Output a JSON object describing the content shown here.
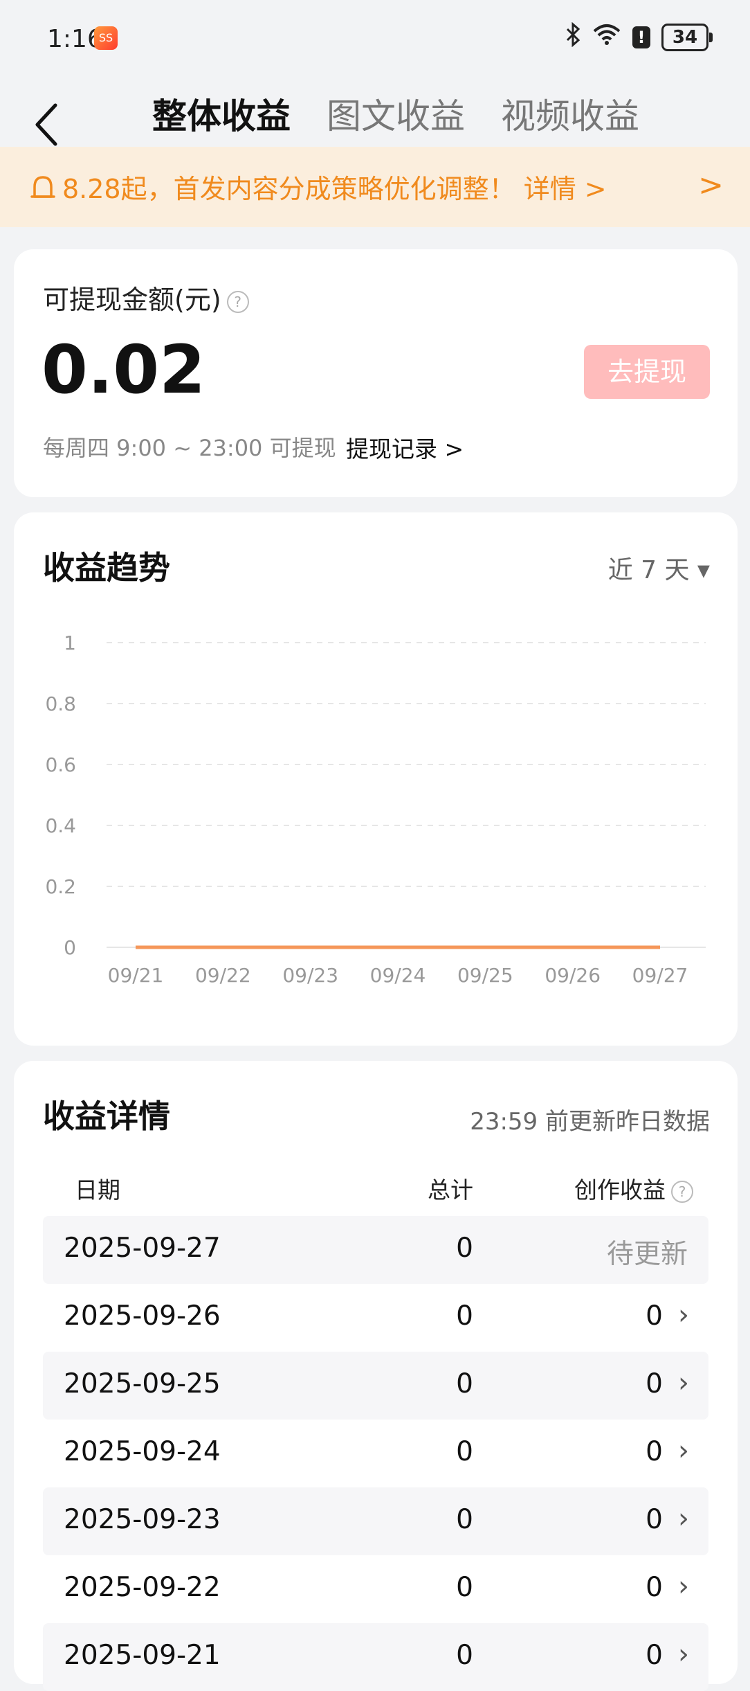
{
  "status_bar": {
    "time": "1:16",
    "app_icon_text": "SS",
    "battery": "34"
  },
  "nav": {
    "tabs": [
      {
        "label": "整体收益",
        "active": true
      },
      {
        "label": "图文收益",
        "active": false
      },
      {
        "label": "视频收益",
        "active": false
      }
    ]
  },
  "banner": {
    "text": "8.28起，首发内容分成策略优化调整！ 详情 >",
    "chevron": ">"
  },
  "balance": {
    "label": "可提现金额(元)",
    "help": "?",
    "amount": "0.02",
    "withdraw_label": "去提现",
    "note": "每周四 9:00 ~ 23:00 可提现",
    "record_label": "提现记录 >",
    "withdraw_enabled": false,
    "withdraw_color": "#ffbcbc"
  },
  "trend": {
    "title": "收益趋势",
    "range_label": "近 7 天 ▾"
  },
  "chart_data": {
    "type": "line",
    "x": [
      "09/21",
      "09/22",
      "09/23",
      "09/24",
      "09/25",
      "09/26",
      "09/27"
    ],
    "series": [
      {
        "values": [
          0,
          0,
          0,
          0,
          0,
          0,
          0
        ],
        "color": "#f5975a"
      }
    ],
    "yticks": [
      "0",
      "0.2",
      "0.4",
      "0.6",
      "0.8",
      "1"
    ],
    "ylim": [
      0,
      1
    ],
    "grid": true
  },
  "details": {
    "title": "收益详情",
    "note": "23:59 前更新昨日数据",
    "headers": {
      "date": "日期",
      "total": "总计",
      "creation": "创作收益",
      "help": "?"
    },
    "rows": [
      {
        "date": "2025-09-27",
        "total": "0",
        "creation": "待更新",
        "pending": true
      },
      {
        "date": "2025-09-26",
        "total": "0",
        "creation": "0"
      },
      {
        "date": "2025-09-25",
        "total": "0",
        "creation": "0"
      },
      {
        "date": "2025-09-24",
        "total": "0",
        "creation": "0"
      },
      {
        "date": "2025-09-23",
        "total": "0",
        "creation": "0"
      },
      {
        "date": "2025-09-22",
        "total": "0",
        "creation": "0"
      },
      {
        "date": "2025-09-21",
        "total": "0",
        "creation": "0"
      }
    ]
  }
}
